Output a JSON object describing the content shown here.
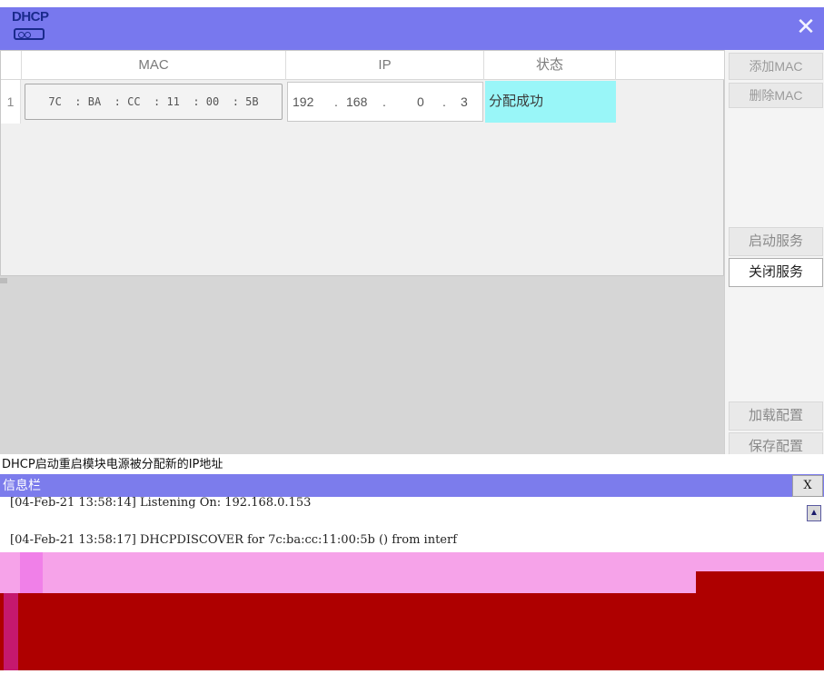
{
  "window": {
    "logo_text": "DHCP",
    "close_glyph": "✕"
  },
  "table": {
    "headers": {
      "mac": "MAC",
      "ip": "IP",
      "status": "状态"
    },
    "rows": [
      {
        "index": "1",
        "mac": "7C  : BA  : CC  : 11  : 00  : 5B",
        "ip": [
          "192",
          ".",
          "168",
          ".",
          "0",
          ".",
          "3"
        ],
        "status": "分配成功"
      }
    ]
  },
  "buttons": {
    "add_mac": "添加MAC",
    "delete_mac": "删除MAC",
    "start_service": "启动服务",
    "stop_service": "关闭服务",
    "load_config": "加载配置",
    "save_config": "保存配置"
  },
  "status_line": "DHCP启动重启模块电源被分配新的IP地址",
  "info_bar": {
    "title": "信息栏",
    "close_label": "X",
    "log": [
      "[04-Feb-21 13:58:14] Listening On: 192.168.0.153",
      "[04-Feb-21 13:58:17] DHCPDISCOVER for 7c:ba:cc:11:00:5b () from interf"
    ]
  },
  "colors": {
    "title_bar": "#7878ee",
    "status_success": "#99f6f8",
    "info_bar": "#7c7cec"
  }
}
